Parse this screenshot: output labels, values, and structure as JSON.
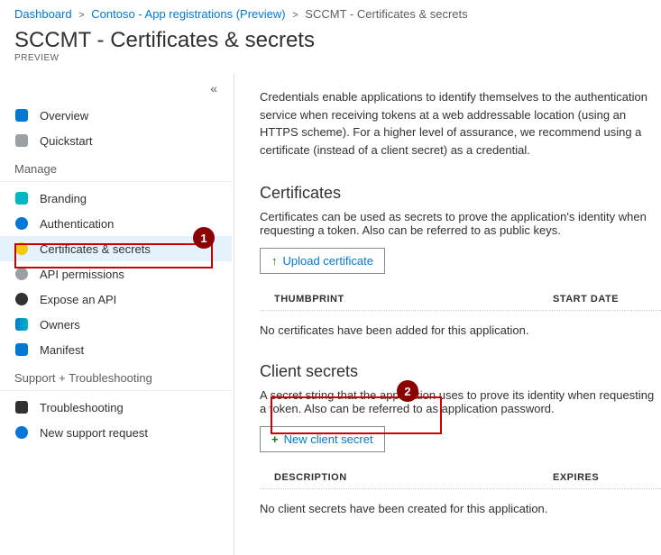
{
  "breadcrumb": {
    "item1": "Dashboard",
    "item2": "Contoso - App registrations (Preview)",
    "item3": "SCCMT - Certificates & secrets"
  },
  "page": {
    "title": "SCCMT - Certificates & secrets",
    "preview": "PREVIEW"
  },
  "sidebar": {
    "items": [
      {
        "label": "Overview",
        "icon": "overview-icon",
        "color": "#0078d4"
      },
      {
        "label": "Quickstart",
        "icon": "quickstart-icon",
        "color": "#605e5c"
      }
    ],
    "manage_header": "Manage",
    "manage": [
      {
        "label": "Branding",
        "icon": "branding-icon",
        "color": "#0078d4"
      },
      {
        "label": "Authentication",
        "icon": "auth-icon",
        "color": "#0078d4"
      },
      {
        "label": "Certificates & secrets",
        "icon": "key-icon",
        "color": "#f2c811",
        "selected": true
      },
      {
        "label": "API permissions",
        "icon": "api-perm-icon",
        "color": "#605e5c"
      },
      {
        "label": "Expose an API",
        "icon": "expose-api-icon",
        "color": "#323130"
      },
      {
        "label": "Owners",
        "icon": "owners-icon",
        "color": "#0078d4"
      },
      {
        "label": "Manifest",
        "icon": "manifest-icon",
        "color": "#0078d4"
      }
    ],
    "support_header": "Support + Troubleshooting",
    "support": [
      {
        "label": "Troubleshooting",
        "icon": "troubleshoot-icon",
        "color": "#323130"
      },
      {
        "label": "New support request",
        "icon": "support-icon",
        "color": "#0078d4"
      }
    ]
  },
  "content": {
    "intro": "Credentials enable applications to identify themselves to the authentication service when receiving tokens at a web addressable location (using an HTTPS scheme). For a higher level of assurance, we recommend using a certificate (instead of a client secret) as a credential.",
    "certificates": {
      "heading": "Certificates",
      "desc": "Certificates can be used as secrets to prove the application's identity when requesting a token. Also can be referred to as public keys.",
      "button": "Upload certificate",
      "col_thumb": "THUMBPRINT",
      "col_start": "START DATE",
      "empty": "No certificates have been added for this application."
    },
    "secrets": {
      "heading": "Client secrets",
      "desc": "A secret string that the application uses to prove its identity when requesting a token. Also can be referred to as application password.",
      "button": "New client secret",
      "col_desc": "DESCRIPTION",
      "col_exp": "EXPIRES",
      "empty": "No client secrets have been created for this application."
    }
  }
}
